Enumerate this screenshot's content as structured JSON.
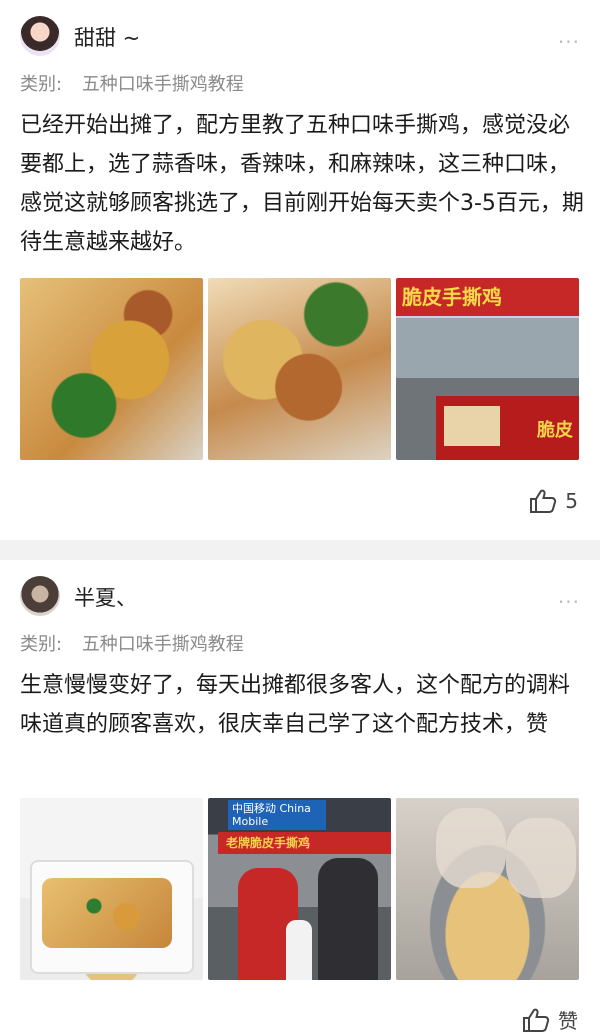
{
  "posts": [
    {
      "username": "甜甜 ~",
      "category_label": "类别:",
      "category_value": "五种口味手撕鸡教程",
      "text": "已经开始出摊了，配方里教了五种口味手撕鸡，感觉没必要都上，选了蒜香味，香辣味，和麻辣味，这三种口味，感觉这就够顾客挑选了，目前刚开始每天卖个3-5百元，期待生意越来越好。",
      "photo_sign": "脆皮手撕鸡",
      "photo_cart_text": "脆皮",
      "likes": "5"
    },
    {
      "username": "半夏、",
      "category_label": "类别:",
      "category_value": "五种口味手撕鸡教程",
      "text": "生意慢慢变好了，每天出摊都很多客人，这个配方的调料味道真的顾客喜欢，很庆幸自己学了这个配方技术，赞",
      "photo_cm": "中国移动 China Mobile",
      "photo_banner": "老牌脆皮手撕鸡",
      "likes": "赞"
    }
  ],
  "more_icon": "...",
  "icons": {
    "more": "more-dots-icon",
    "like": "thumbs-up-icon"
  }
}
